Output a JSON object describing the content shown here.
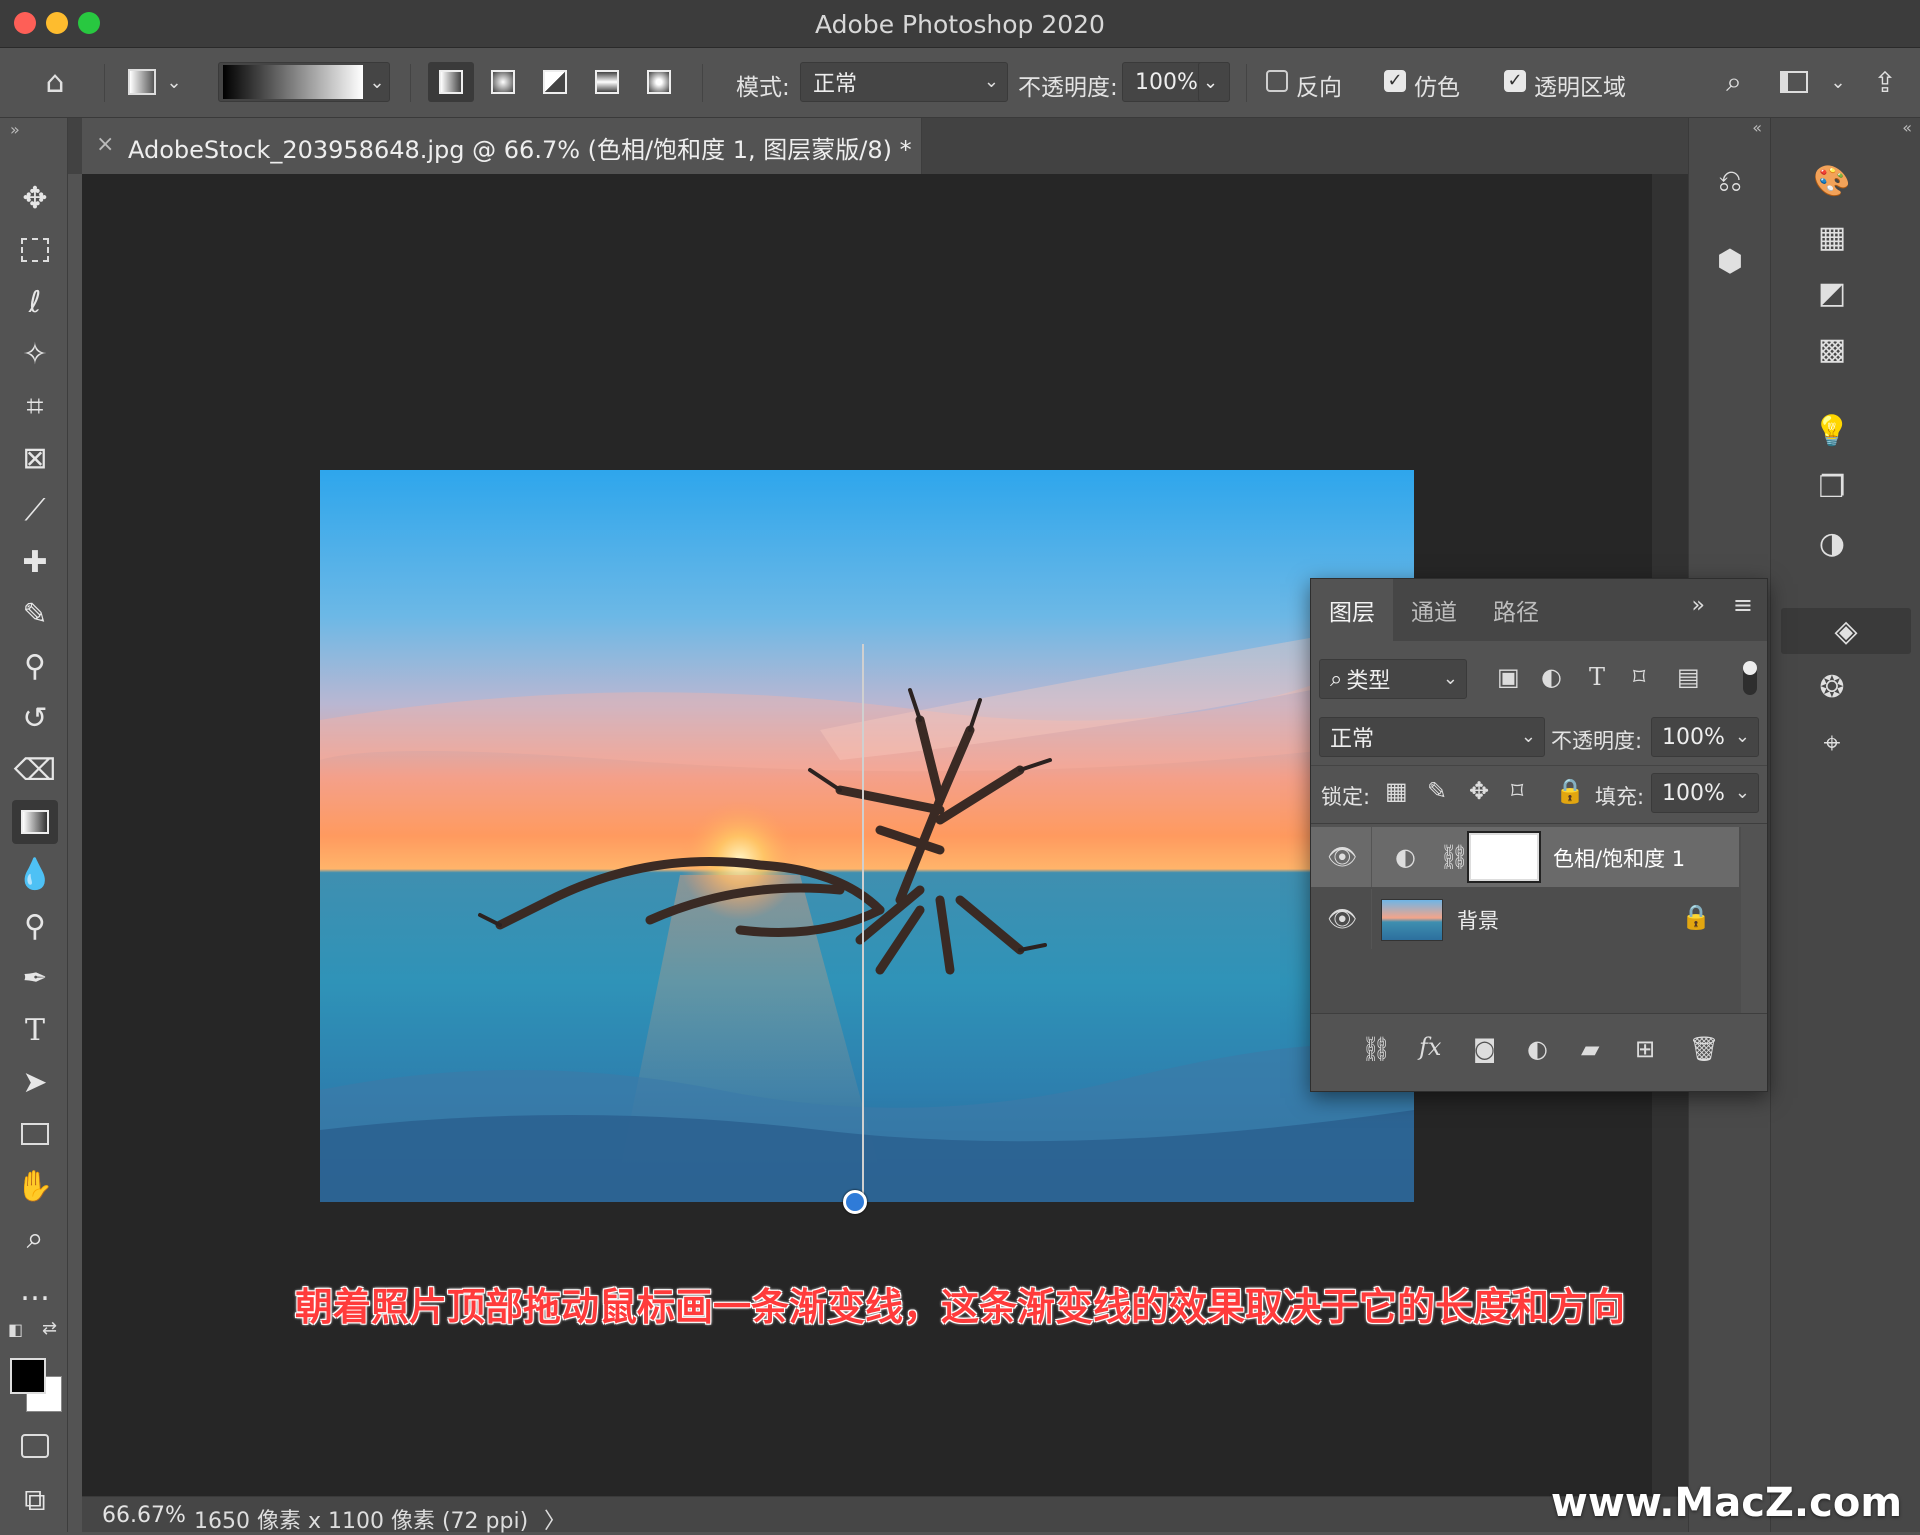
{
  "window": {
    "title": "Adobe Photoshop 2020"
  },
  "options_bar": {
    "mode_label": "模式:",
    "mode_value": "正常",
    "opacity_label": "不透明度:",
    "opacity_value": "100%",
    "reverse_label": "反向",
    "reverse_checked": false,
    "dither_label": "仿色",
    "dither_checked": true,
    "transparency_label": "透明区域",
    "transparency_checked": true
  },
  "document": {
    "tab_title": "AdobeStock_203958648.jpg @ 66.7% (色相/饱和度 1, 图层蒙版/8) *",
    "close_glyph": "×"
  },
  "caption": "朝着照片顶部拖动鼠标画一条渐变线，这条渐变线的效果取决于它的长度和方向",
  "status_bar": {
    "zoom": "66.67%",
    "doc_info": "1650 像素 x 1100 像素 (72 ppi)",
    "arrow": "〉"
  },
  "layers_panel": {
    "tabs": [
      "图层",
      "通道",
      "路径"
    ],
    "active_tab": 0,
    "filter_kind": "类型",
    "blend_mode": "正常",
    "opacity_label": "不透明度:",
    "opacity_value": "100%",
    "lock_label": "锁定:",
    "fill_label": "填充:",
    "fill_value": "100%",
    "layers": [
      {
        "name": "色相/饱和度 1",
        "visible": true,
        "selected": true,
        "type": "adjustment"
      },
      {
        "name": "背景",
        "visible": true,
        "selected": false,
        "locked": true,
        "type": "image"
      }
    ]
  },
  "watermark": "www.MacZ.com",
  "colors": {
    "accent_handle": "#2f7bd8",
    "caption_red": "#ff3b3b",
    "ui_bg": "#535353",
    "canvas_bg": "#262626"
  }
}
